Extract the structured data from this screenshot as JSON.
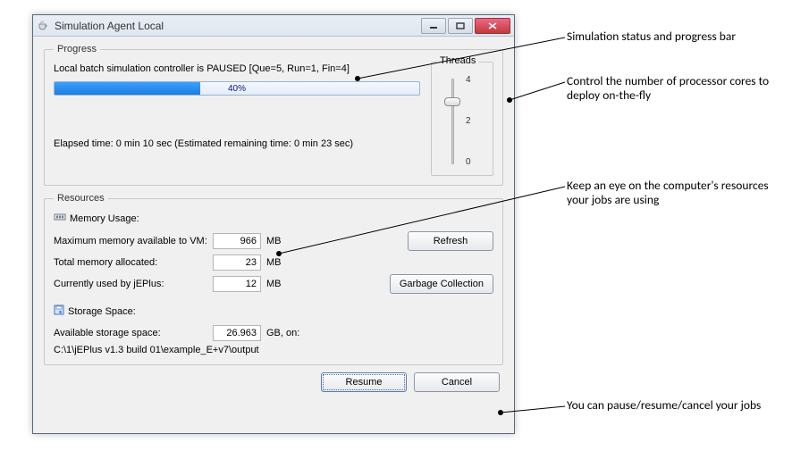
{
  "window": {
    "title": "Simulation Agent Local"
  },
  "progress": {
    "legend": "Progress",
    "status": "Local batch simulation controller is PAUSED [Que=5, Run=1, Fin=4]",
    "percent": 40,
    "percent_label": "40%",
    "elapsed": "Elapsed time: 0 min 10 sec (Estimated remaining time: 0 min 23 sec)"
  },
  "threads": {
    "legend": "Threads",
    "ticks": [
      "4",
      "2",
      "0"
    ],
    "value": 3
  },
  "resources": {
    "legend": "Resources",
    "memory_header": "Memory Usage:",
    "max_vm_label": "Maximum memory available to VM:",
    "max_vm_value": "966",
    "max_vm_unit": "MB",
    "total_alloc_label": "Total memory allocated:",
    "total_alloc_value": "23",
    "total_alloc_unit": "MB",
    "used_label": "Currently used by jEPlus:",
    "used_value": "12",
    "used_unit": "MB",
    "refresh_label": "Refresh",
    "gc_label": "Garbage Collection",
    "storage_header": "Storage Space:",
    "avail_label": "Available storage space:",
    "avail_value": "26.963",
    "avail_unit": "GB, on:",
    "path": "C:\\1\\jEPlus v1.3 build 01\\example_E+v7\\output"
  },
  "footer": {
    "resume_label": "Resume",
    "cancel_label": "Cancel"
  },
  "annotations": {
    "a1": "Simulation status and progress bar",
    "a2": "Control the number of processor cores to deploy on-the-fly",
    "a3": "Keep an eye on the computer's resources your jobs are using",
    "a4": "You can pause/resume/cancel your jobs"
  }
}
